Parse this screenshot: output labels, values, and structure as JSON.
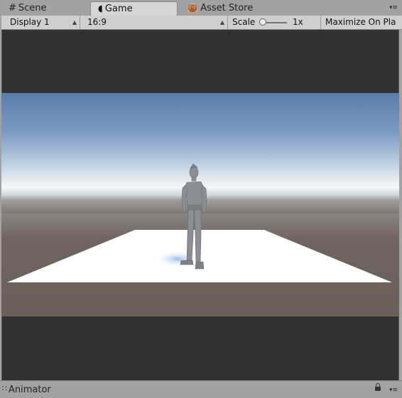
{
  "tabs": [
    {
      "label": "Scene",
      "icon": "hash-icon"
    },
    {
      "label": "Game",
      "icon": "pacman-icon",
      "active": true
    },
    {
      "label": "Asset Store",
      "icon": "shopping-bag-icon"
    }
  ],
  "tab_menu_icon": "tab-menu-icon",
  "toolbar": {
    "display_label": "Display 1",
    "aspect_label": "16:9",
    "scale_label": "Scale",
    "scale_value": "1x",
    "scale_level": 0.0,
    "maximize_label": "Maximize On Pla"
  },
  "game_view": {
    "background_color": "#313131",
    "sky_top_color": "#5b7cab",
    "horizon_color": "#f2f4f5",
    "ground_color": "#6c625c",
    "plane_color": "#ffffff",
    "character_color": "#8b8e92"
  },
  "bottom_panel": {
    "label": "Animator",
    "icon": "animator-icon"
  }
}
